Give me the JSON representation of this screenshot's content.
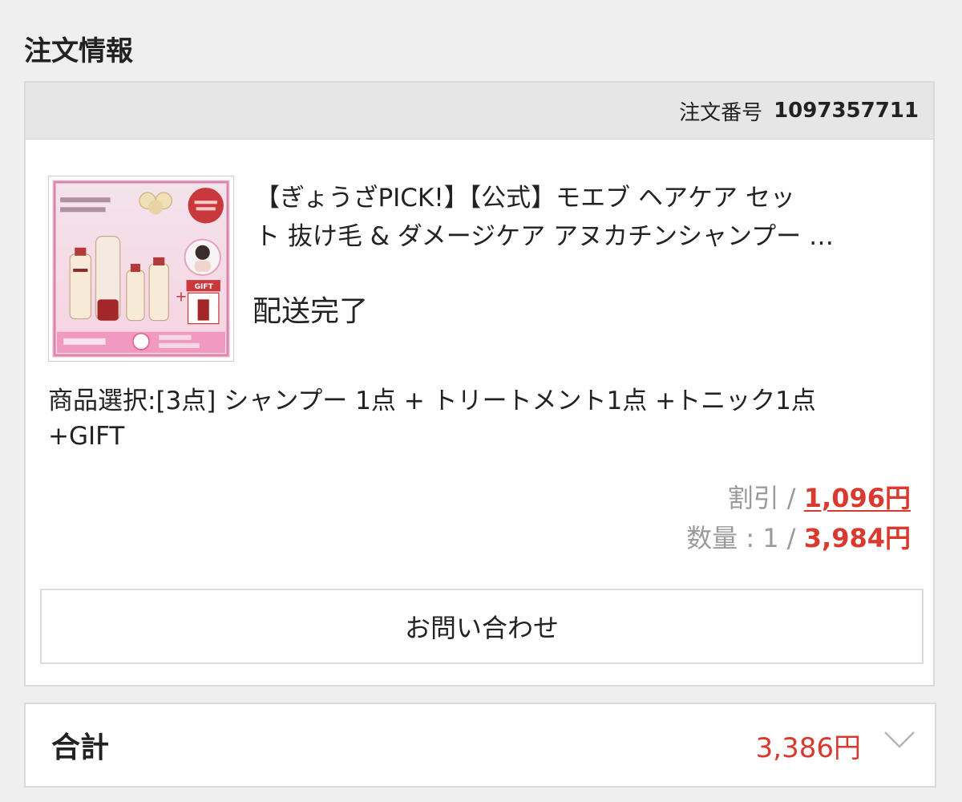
{
  "section": {
    "title": "注文情報"
  },
  "order": {
    "number_label": "注文番号",
    "number": "1097357711",
    "product": {
      "title_line1": "【ぎょうざPICK!】【公式】モエブ ヘアケア セッ",
      "title_line2": "ト 抜け毛 & ダメージケア アヌカチンシャンプー …",
      "thumbnail_icon": "product-set-image",
      "status": "配送完了",
      "variant_line1": "商品選択:[3点] シャンプー 1点 + トリートメント1点 +トニック1点",
      "variant_line2": "+GIFT"
    },
    "discount_label": "割引 / ",
    "discount_amount": "1,096円",
    "quantity_label": "数量 : 1 / ",
    "price_amount": "3,984円",
    "contact_button_label": "お問い合わせ"
  },
  "total": {
    "label": "合計",
    "value": "3,386円",
    "expand_icon": "chevron-down-icon"
  },
  "colors": {
    "accent_red": "#d93a2f",
    "header_bg": "#e6e6e6",
    "page_bg": "#efefef"
  }
}
